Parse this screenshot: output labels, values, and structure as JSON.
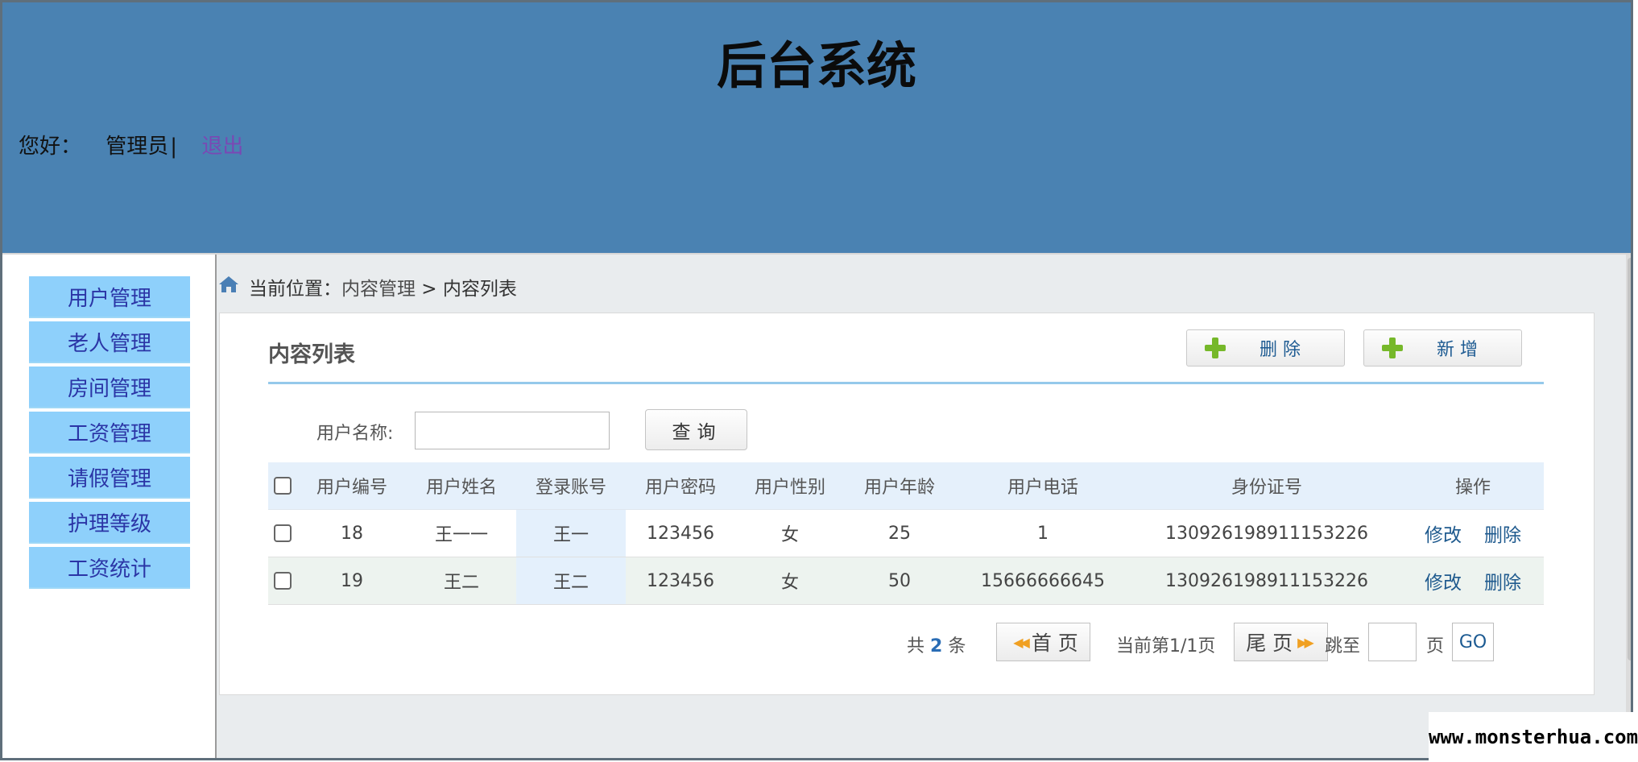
{
  "header": {
    "title": "后台系统",
    "greeting": "您好：",
    "user": "管理员",
    "separator": "|",
    "logout": "退出",
    "bg_color": "#4a82b2"
  },
  "sidebar": {
    "items": [
      {
        "label": "用户管理"
      },
      {
        "label": "老人管理"
      },
      {
        "label": "房间管理"
      },
      {
        "label": "工资管理"
      },
      {
        "label": "请假管理"
      },
      {
        "label": "护理等级"
      },
      {
        "label": "工资统计"
      }
    ]
  },
  "breadcrumb": {
    "prefix": "当前位置：",
    "section": "内容管理",
    "arrow": " > ",
    "current": "内容列表",
    "icon": "home-icon"
  },
  "panel": {
    "title": "内容列表",
    "delete_label": "删 除",
    "add_label": "新 增"
  },
  "search": {
    "label": "用户名称:",
    "value": "",
    "placeholder": "",
    "button": "查询"
  },
  "table": {
    "columns": [
      "用户编号",
      "用户姓名",
      "登录账号",
      "用户密码",
      "用户性别",
      "用户年龄",
      "用户电话",
      "身份证号",
      "操作"
    ],
    "rows": [
      {
        "id": "18",
        "name": "王一一",
        "account": "王一",
        "password": "123456",
        "gender": "女",
        "age": "25",
        "phone": "1",
        "id_card": "130926198911153226"
      },
      {
        "id": "19",
        "name": "王二",
        "account": "王二",
        "password": "123456",
        "gender": "女",
        "age": "50",
        "phone": "15666666645",
        "id_card": "130926198911153226"
      }
    ],
    "edit_label": "修改",
    "delete_label": "删除"
  },
  "pager": {
    "total_prefix": "共",
    "total": "2",
    "total_suffix": "条",
    "first": "首 页",
    "current": "当前第1/1页",
    "last": "尾 页",
    "jump_label": "跳至",
    "page_unit": "页",
    "go": "GO",
    "jump_value": ""
  },
  "watermark": "www.monsterhua.com"
}
